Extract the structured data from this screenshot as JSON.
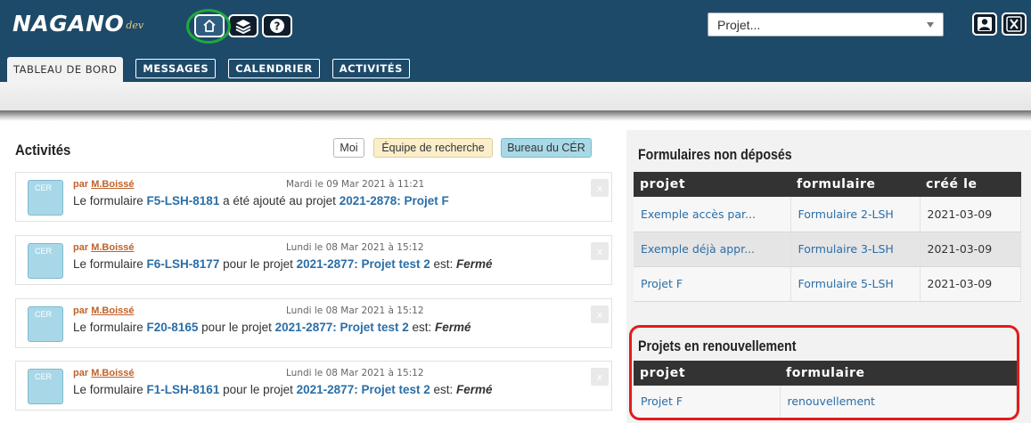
{
  "header": {
    "logo_main": "NAGANO",
    "logo_sub": "dev",
    "project_select": {
      "placeholder": "Projet..."
    },
    "icons": [
      "home-icon",
      "layers-icon",
      "help-icon",
      "user-icon",
      "logout-icon"
    ]
  },
  "tabs": [
    {
      "label": "TABLEAU DE BORD",
      "active": true
    },
    {
      "label": "MESSAGES",
      "active": false
    },
    {
      "label": "CALENDRIER",
      "active": false
    },
    {
      "label": "ACTIVITÉS",
      "active": false
    }
  ],
  "activities": {
    "title": "Activités",
    "filters": [
      "Moi",
      "Équipe de recherche",
      "Bureau du CÉR"
    ],
    "items": [
      {
        "badge": "CER",
        "by": "par",
        "author": "M.Boissé",
        "date": "Mardi le 09 Mar 2021 à 11:21",
        "pre": "Le formulaire ",
        "form": "F5-LSH-8181",
        "mid": " a été ajouté au projet ",
        "project": "2021-2878: Projet F",
        "post": "",
        "status": "",
        "close": "x"
      },
      {
        "badge": "CER",
        "by": "par",
        "author": "M.Boissé",
        "date": "Lundi le 08 Mar 2021 à 15:12",
        "pre": "Le formulaire ",
        "form": "F6-LSH-8177",
        "mid": " pour le projet ",
        "project": "2021-2877: Projet test 2",
        "post": " est: ",
        "status": "Fermé",
        "close": "x"
      },
      {
        "badge": "CER",
        "by": "par",
        "author": "M.Boissé",
        "date": "Lundi le 08 Mar 2021 à 15:12",
        "pre": "Le formulaire ",
        "form": "F20-8165",
        "mid": " pour le projet ",
        "project": "2021-2877: Projet test 2",
        "post": " est: ",
        "status": "Fermé",
        "close": "x"
      },
      {
        "badge": "CER",
        "by": "par",
        "author": "M.Boissé",
        "date": "Lundi le 08 Mar 2021 à 15:12",
        "pre": "Le formulaire ",
        "form": "F1-LSH-8161",
        "mid": " pour le projet ",
        "project": "2021-2877: Projet test 2",
        "post": " est: ",
        "status": "Fermé",
        "close": "x"
      }
    ]
  },
  "forms_not_submitted": {
    "title": "Formulaires non déposés",
    "columns": [
      "projet",
      "formulaire",
      "créé le"
    ],
    "rows": [
      [
        "Exemple accès par...",
        "Formulaire 2-LSH",
        "2021-03-09"
      ],
      [
        "Exemple déjà appr...",
        "Formulaire 3-LSH",
        "2021-03-09"
      ],
      [
        "Projet F",
        "Formulaire 5-LSH",
        "2021-03-09"
      ]
    ]
  },
  "renewals": {
    "title": "Projets en renouvellement",
    "columns": [
      "projet",
      "formulaire"
    ],
    "rows": [
      [
        "Projet F",
        "renouvellement"
      ]
    ]
  },
  "colors": {
    "header_bg": "#1e4a6a",
    "link": "#2a6ea8",
    "author": "#c0622a",
    "highlight_green": "#1faa3c",
    "highlight_red": "#e31b1b"
  }
}
